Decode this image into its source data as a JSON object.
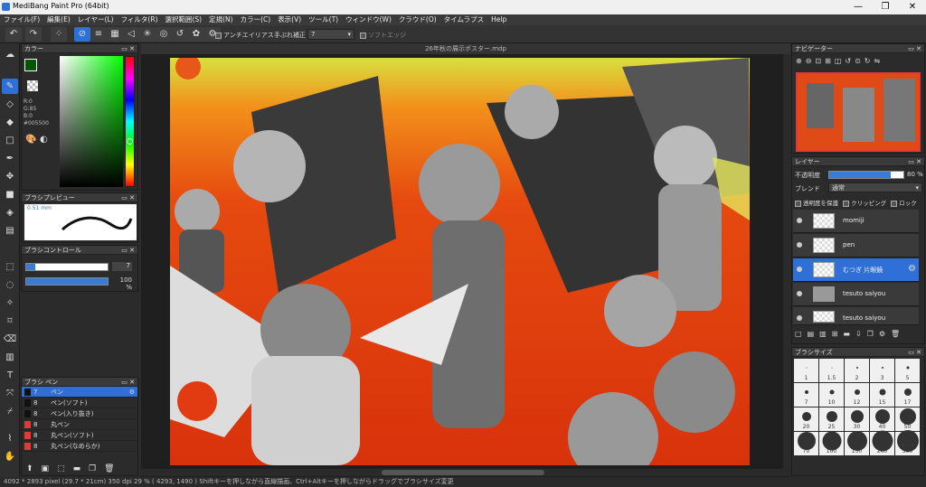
{
  "window": {
    "title": "MediBang Paint Pro (64bit)",
    "min": "—",
    "max": "❐",
    "close": "✕"
  },
  "menu": [
    "ファイル(F)",
    "編集(E)",
    "レイヤー(L)",
    "フィルタ(R)",
    "選択範囲(S)",
    "定規(N)",
    "カラー(C)",
    "表示(V)",
    "ツール(T)",
    "ウィンドウ(W)",
    "クラウド(O)",
    "タイムラプス",
    "Help"
  ],
  "toolbar": {
    "antialias": "アンチエイリアス",
    "correction": "手ぶれ補正",
    "correction_value": "7",
    "soft_edge": "ソフトエッジ"
  },
  "color_panel": {
    "title": "カラー",
    "r": "R:0",
    "g": "G:85",
    "b": "B:0",
    "hex": "#005500"
  },
  "brush_preview": {
    "title": "ブラシプレビュー",
    "size": "0.51 mm"
  },
  "brush_control": {
    "title": "ブラシコントロール",
    "size_value": "7",
    "opacity_value": "100 %"
  },
  "brush_list": {
    "title": "ブラシ ペン",
    "items": [
      {
        "size": "7",
        "label": "ペン",
        "selected": true
      },
      {
        "size": "8",
        "label": "ペン(ソフト)",
        "selected": false
      },
      {
        "size": "8",
        "label": "ペン(入り抜き)",
        "selected": false
      },
      {
        "size": "8",
        "label": "丸ペン",
        "selected": false
      },
      {
        "size": "8",
        "label": "丸ペン(ソフト)",
        "selected": false
      },
      {
        "size": "8",
        "label": "丸ペン(なめらか)",
        "selected": false
      }
    ]
  },
  "document": {
    "tab": "26年秋の展示ポスター.mdp"
  },
  "navigator": {
    "title": "ナビゲーター"
  },
  "layer_panel": {
    "title": "レイヤー",
    "opacity_label": "不透明度",
    "opacity_value": "80 %",
    "blend_label": "ブレンド",
    "blend_value": "通常",
    "protect_label": "透明度を保護",
    "clip_label": "クリッピング",
    "lock_label": "ロック",
    "layers": [
      {
        "name": "momiji",
        "selected": false
      },
      {
        "name": "pen",
        "selected": false
      },
      {
        "name": "むつぎ 片眼鏡",
        "selected": true
      },
      {
        "name": "tesuto saiyou",
        "selected": false
      },
      {
        "name": "tesuto saiyou",
        "selected": false
      }
    ]
  },
  "brush_size": {
    "title": "ブラシサイズ",
    "sizes": [
      "1",
      "1.5",
      "2",
      "3",
      "5",
      "7",
      "10",
      "12",
      "15",
      "17",
      "20",
      "25",
      "30",
      "40",
      "50",
      "70",
      "100",
      "150",
      "200",
      "300"
    ]
  },
  "status": "4092 * 2893 pixel  (29.7 * 21cm)  350 dpi  29 %  ( 4293, 1490 )  Shiftキーを押しながら直線描画、Ctrl+Altキーを押しながらドラッグでブラシサイズ変更",
  "colors": {
    "accent": "#2e6fd8",
    "foreground": "#005500",
    "canvas_bg": "#e8420f"
  }
}
